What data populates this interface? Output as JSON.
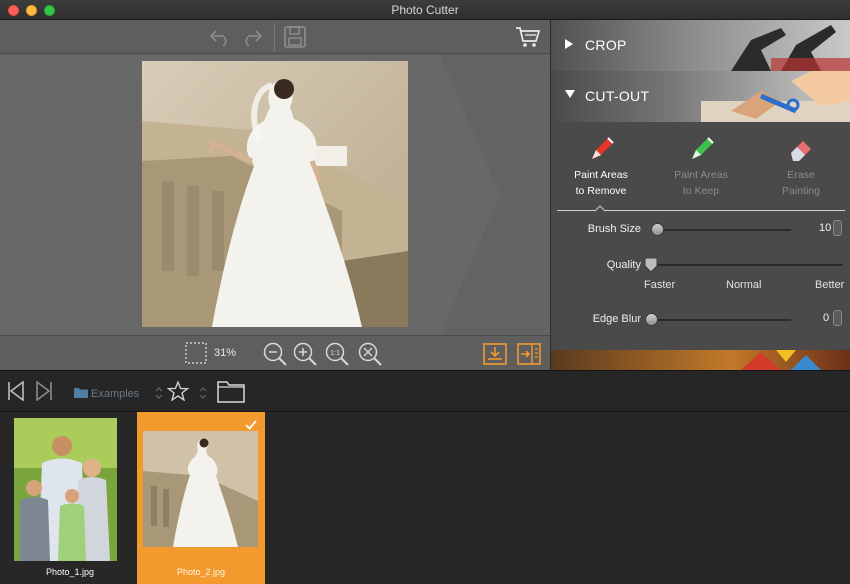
{
  "window": {
    "title": "Photo Cutter"
  },
  "toolbar": {
    "undo_icon": "undo-icon",
    "redo_icon": "redo-icon",
    "save_icon": "save-icon",
    "cart_icon": "cart-icon"
  },
  "zoom": {
    "value": "31%"
  },
  "panel": {
    "crop": {
      "label": "CROP"
    },
    "cutout": {
      "label": "CUT-OUT"
    },
    "tools": [
      {
        "line1": "Paint Areas",
        "line2": "to Remove",
        "active": true
      },
      {
        "line1": "Paint Areas",
        "line2": "to Keep",
        "active": false
      },
      {
        "line1": "Erase",
        "line2": "Painting",
        "active": false
      }
    ],
    "brush_size": {
      "label": "Brush Size",
      "value": "10",
      "level": 0.0
    },
    "quality": {
      "label": "Quality",
      "marks": [
        "Faster",
        "Normal",
        "Better"
      ],
      "level": 0.0
    },
    "edge_blur": {
      "label": "Edge Blur",
      "value": "0",
      "level": 0.0
    }
  },
  "browser": {
    "folder": "Examples"
  },
  "thumbnails": [
    {
      "name": "Photo_1.jpg",
      "selected": false
    },
    {
      "name": "Photo_2.jpg",
      "selected": true
    }
  ],
  "colors": {
    "accent": "#f29a2e",
    "paint_remove": "#e8352b",
    "paint_keep": "#3cc24a",
    "erase": "#e86f6f"
  }
}
